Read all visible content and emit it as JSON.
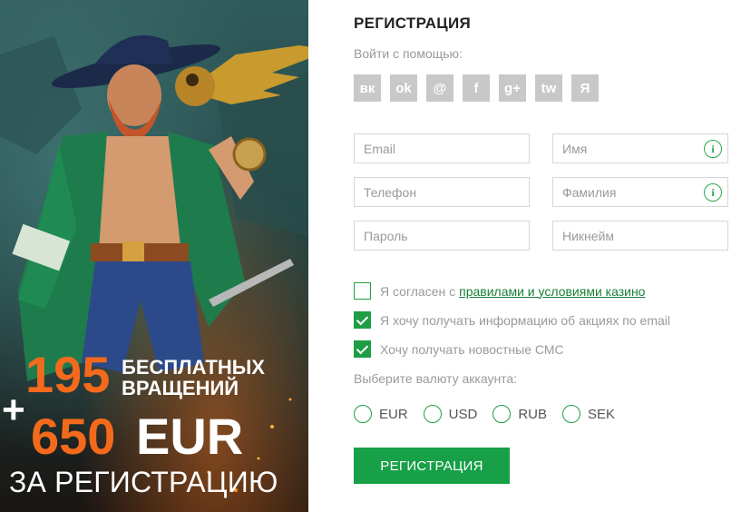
{
  "promo": {
    "spins_number": "195",
    "spins_text": "БЕСПЛАТНЫХ ВРАЩЕНИЙ",
    "plus": "+",
    "bonus_amount": "650",
    "bonus_currency": "EUR",
    "for_registration": "ЗА РЕГИСТРАЦИЮ"
  },
  "form": {
    "title": "РЕГИСТРАЦИЯ",
    "login_with": "Войти с помощью:",
    "socials": [
      {
        "name": "vk-icon",
        "glyph": "вк"
      },
      {
        "name": "odnoklassniki-icon",
        "glyph": "ok"
      },
      {
        "name": "mail-icon",
        "glyph": "@"
      },
      {
        "name": "facebook-icon",
        "glyph": "f"
      },
      {
        "name": "google-plus-icon",
        "glyph": "g+"
      },
      {
        "name": "twitter-icon",
        "glyph": "tw"
      },
      {
        "name": "yandex-icon",
        "glyph": "Я"
      }
    ],
    "fields": {
      "email": {
        "placeholder": "Email",
        "value": ""
      },
      "first_name": {
        "placeholder": "Имя",
        "value": ""
      },
      "phone": {
        "placeholder": "Телефон",
        "value": ""
      },
      "last_name": {
        "placeholder": "Фамилия",
        "value": ""
      },
      "password": {
        "placeholder": "Пароль",
        "value": ""
      },
      "nickname": {
        "placeholder": "Никнейм",
        "value": ""
      }
    },
    "info_icon": "i",
    "checks": {
      "terms": {
        "text": "Я согласен с",
        "link": "правилами и условиями казино",
        "checked": false
      },
      "email_promo": {
        "text": "Я хочу получать информацию об акциях по email",
        "checked": true
      },
      "sms_news": {
        "text": "Хочу получать новостные СМС",
        "checked": true
      }
    },
    "currency_label": "Выберите валюту аккаунта:",
    "currencies": [
      "EUR",
      "USD",
      "RUB",
      "SEK"
    ],
    "submit_label": "РЕГИСТРАЦИЯ"
  },
  "colors": {
    "accent_green": "#17a048",
    "promo_orange": "#f46a1c",
    "social_gray": "#c8c8c8"
  }
}
